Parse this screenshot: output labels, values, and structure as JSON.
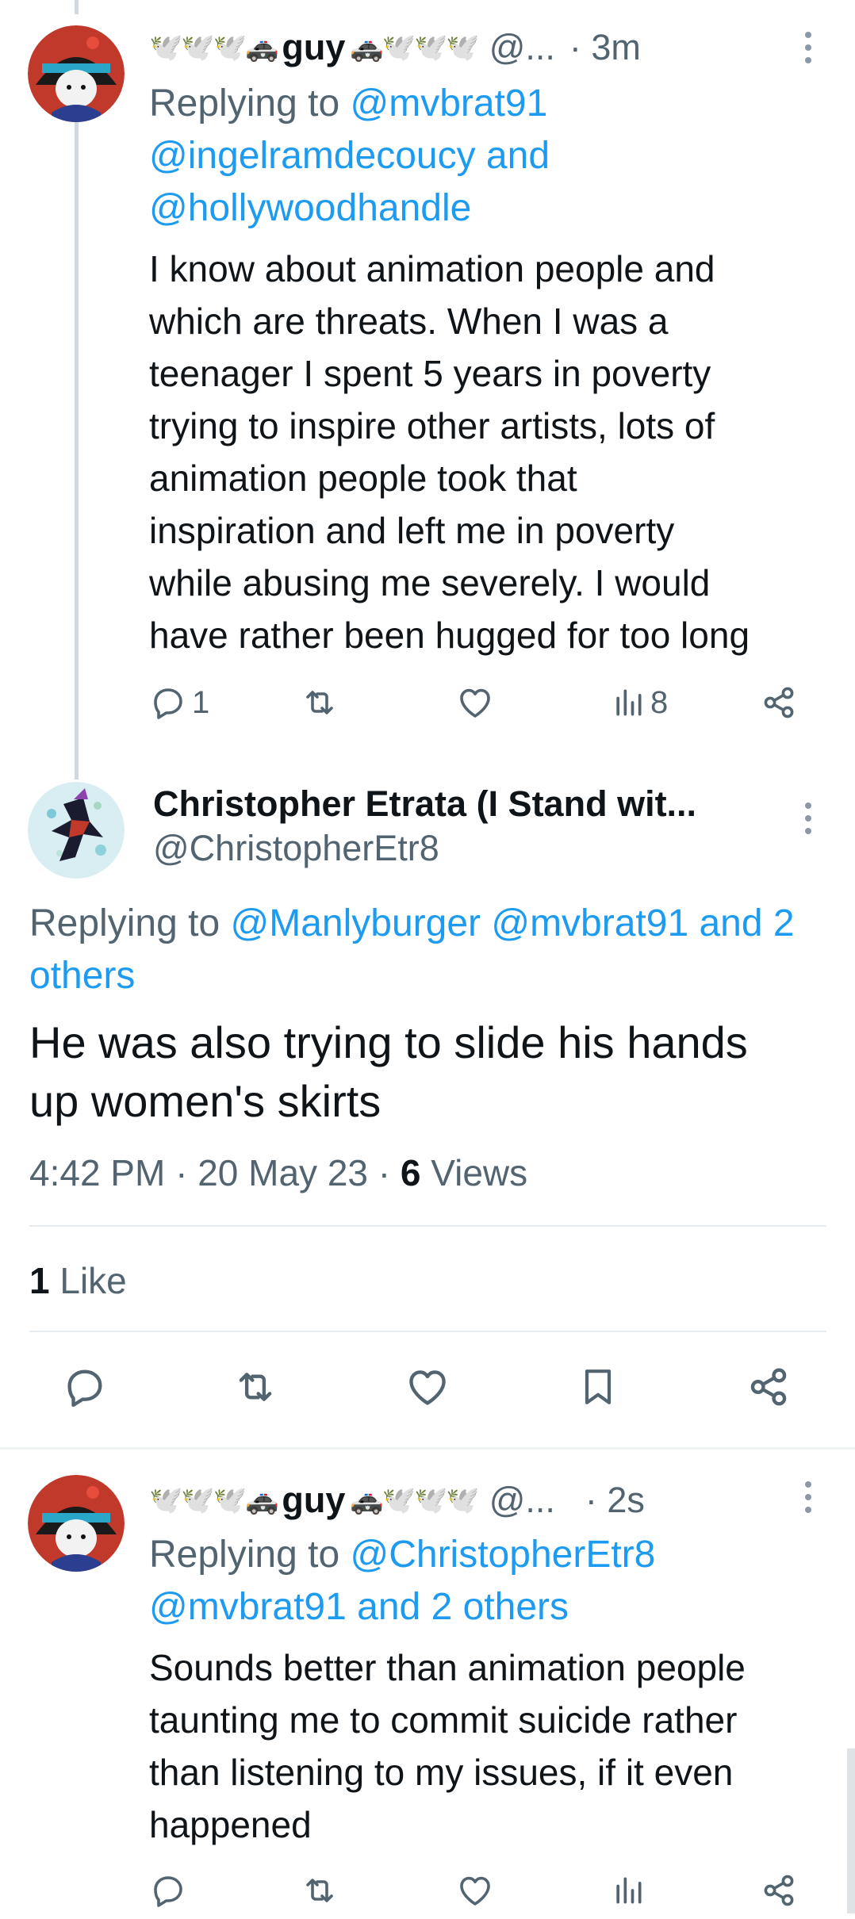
{
  "tweet1": {
    "display_name_prefix": "🕊️🕊️🕊️🚓",
    "display_name_main": "guy",
    "display_name_suffix": "🚓🕊️🕊️🕊️",
    "handle": "@...",
    "time": "· 3m",
    "replying_to_label": "Replying to",
    "replying_to_lines": [
      "@mvbrat91",
      "@ingelramdecoucy and",
      "@hollywoodhandle"
    ],
    "text_lines": [
      "I know about animation people and",
      "which are threats. When I was a",
      "teenager I spent 5 years in poverty",
      "trying to inspire other artists, lots of",
      "animation people took that",
      "inspiration and left me in poverty",
      "while abusing me severely. I would",
      "have rather been hugged for too long"
    ],
    "reply_count": "1",
    "view_count": "8"
  },
  "main_tweet": {
    "display_name": "Christopher Etrata (I Stand wit...",
    "handle": "@ChristopherEtr8",
    "replying_to_label": "Replying to",
    "replying_to_line1": "@Manlyburger @mvbrat91 and 2",
    "replying_to_line2": "others",
    "text_lines": [
      "He was also trying to slide his hands",
      "up women's skirts"
    ],
    "timestamp": "4:42 PM · 20 May 23 · ",
    "views_count": "6",
    "views_label": " Views",
    "likes_count": "1",
    "likes_label": " Like"
  },
  "tweet3": {
    "display_name_prefix": "🕊️🕊️🕊️🚓",
    "display_name_main": "guy",
    "display_name_suffix": "🚓🕊️🕊️🕊️",
    "handle": "@...",
    "time": "· 2s",
    "replying_to_label": "Replying to",
    "replying_to_line1": "@ChristopherEtr8",
    "replying_to_line2": "@mvbrat91 and 2 others",
    "text_lines": [
      "Sounds better than animation people",
      "taunting me to commit suicide rather",
      "than listening to my issues, if it even",
      "happened"
    ]
  },
  "icons": {
    "reply": "reply-icon",
    "retweet": "retweet-icon",
    "like": "heart-icon",
    "views": "views-icon",
    "share": "share-icon",
    "bookmark": "bookmark-icon",
    "more": "more-icon"
  },
  "colors": {
    "link": "#1d9bf0",
    "secondary": "#536471",
    "text": "#0f1419"
  }
}
